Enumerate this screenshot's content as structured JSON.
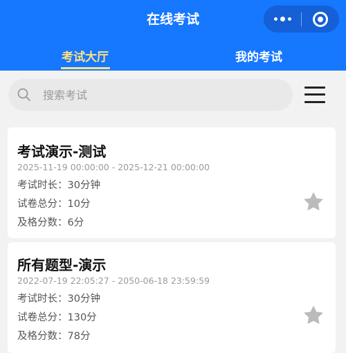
{
  "header": {
    "title": "在线考试",
    "tabs": [
      {
        "label": "考试大厅",
        "active": true
      },
      {
        "label": "我的考试",
        "active": false
      }
    ]
  },
  "search": {
    "placeholder": "搜索考试"
  },
  "colors": {
    "header_bg": "#1677ff",
    "active_tab": "#ffe27a",
    "star": "#bbbbbb"
  },
  "exams": [
    {
      "title": "考试演示-测试",
      "period": "2025-11-19 00:00:00 - 2025-12-21 00:00:00",
      "duration": "考试时长：30分钟",
      "total_score": "试卷总分：10分",
      "pass_score": "及格分数：6分",
      "favorite_icon": "star-icon"
    },
    {
      "title": "所有题型-演示",
      "period": "2022-07-19 22:05:27 - 2050-06-18 23:59:59",
      "duration": "考试时长：30分钟",
      "total_score": "试卷总分：130分",
      "pass_score": "及格分数：78分",
      "favorite_icon": "star-icon"
    }
  ]
}
